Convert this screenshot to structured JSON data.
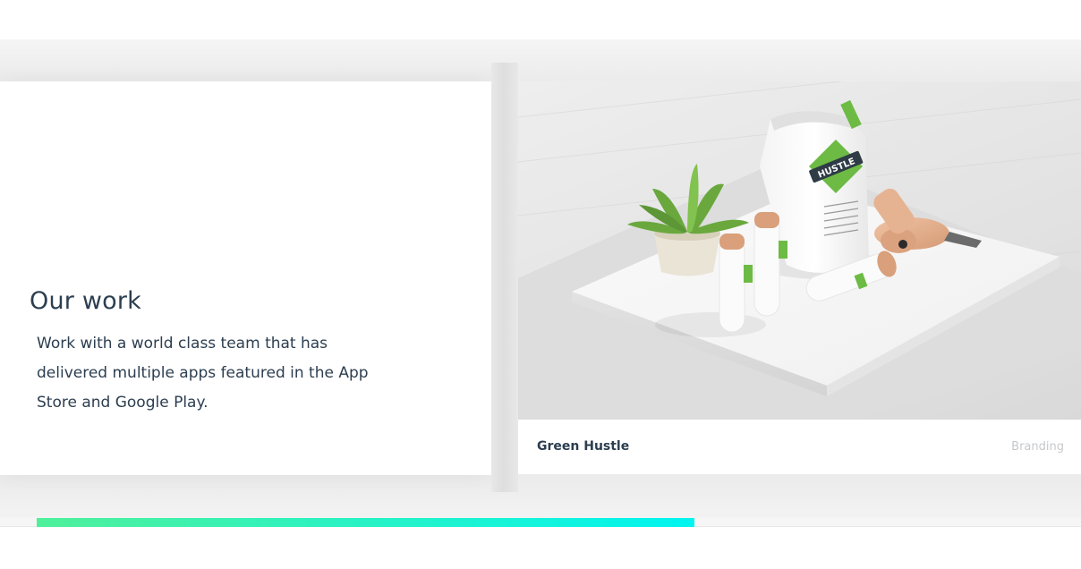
{
  "intro": {
    "title": "Our work",
    "description": "Work with a world class team that has delivered multiple apps featured in the App Store and Google Play."
  },
  "project": {
    "name": "Green Hustle",
    "category": "Branding",
    "image": {
      "logo_text": "HUSTLE",
      "logo_color": "#6dbb45"
    }
  },
  "progress": {
    "fraction": 0.63,
    "start_color": "#4ff09a",
    "end_color": "#00f5f0"
  }
}
